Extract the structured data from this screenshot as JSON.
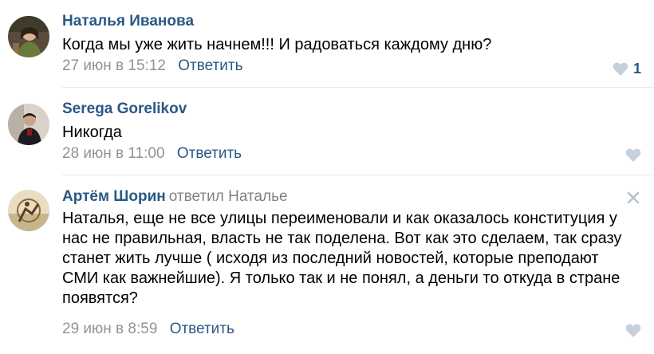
{
  "comments": [
    {
      "author": "Наталья Иванова",
      "reply_to": "",
      "text": "Когда мы уже жить начнем!!! И радоваться каждому дню?",
      "date": "27 июн в 15:12",
      "reply_label": "Ответить",
      "likes": "1"
    },
    {
      "author": "Serega Gorelikov",
      "reply_to": "",
      "text": "Никогда",
      "date": "28 июн в 11:00",
      "reply_label": "Ответить",
      "likes": ""
    },
    {
      "author": "Артём Шорин",
      "reply_to": "ответил Наталье",
      "text": "Наталья, еще не все улицы переименовали и как оказалось конституция у нас не правильная, власть не так поделена. Вот как это сделаем, так сразу станет жить лучше ( исходя из последний новостей, которые преподают СМИ как важнейшие). Я только так и не понял, а деньги то откуда в стране появятся?",
      "date": "29 июн в 8:59",
      "reply_label": "Ответить",
      "likes": ""
    }
  ],
  "colors": {
    "author": "#2a5885",
    "meta": "#939393",
    "like_icon": "#c5d0db",
    "divider": "#e7e8ec"
  }
}
